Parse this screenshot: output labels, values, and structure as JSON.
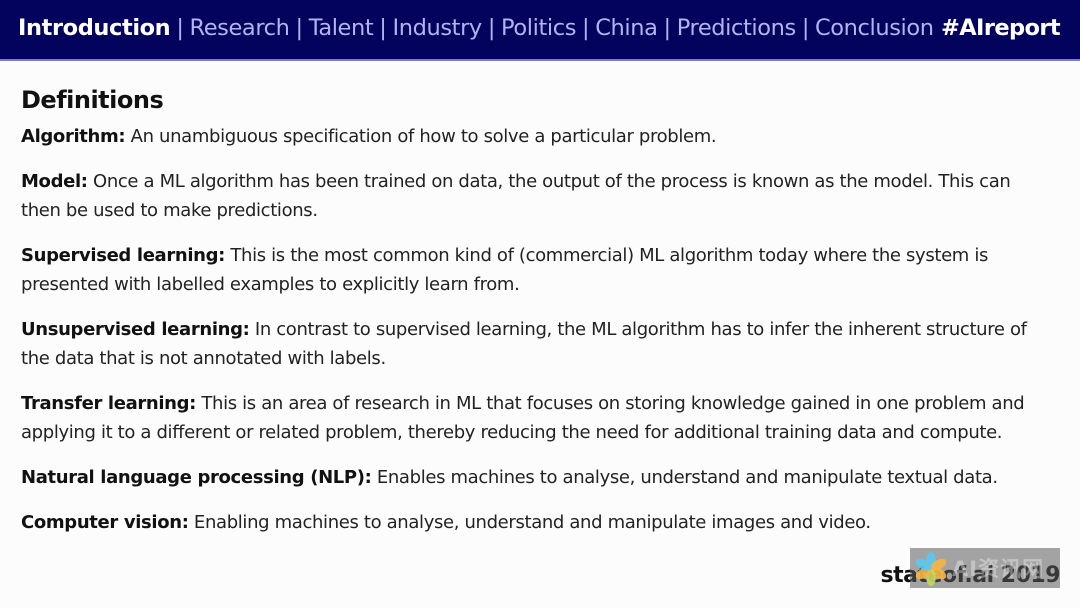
{
  "header": {
    "nav": [
      {
        "label": "Introduction",
        "active": true
      },
      {
        "label": "Research",
        "active": false
      },
      {
        "label": "Talent",
        "active": false
      },
      {
        "label": "Industry",
        "active": false
      },
      {
        "label": "Politics",
        "active": false
      },
      {
        "label": "China",
        "active": false
      },
      {
        "label": "Predictions",
        "active": false
      },
      {
        "label": "Conclusion",
        "active": false
      }
    ],
    "separator": "|",
    "hashtag": "#AIreport",
    "colors": {
      "background": "#03035e",
      "inactive": "#b3b3f0",
      "active": "#ffffff"
    }
  },
  "main": {
    "title": "Definitions",
    "definitions": [
      {
        "term": "Algorithm:",
        "text": " An unambiguous specification of how to solve a particular problem."
      },
      {
        "term": "Model:",
        "text": " Once a ML algorithm has been trained on data, the output of the process is known as the model. This can then be used to make predictions."
      },
      {
        "term": "Supervised learning:",
        "text": " This is the most common kind of (commercial) ML algorithm today where the system is presented with labelled examples to explicitly learn from."
      },
      {
        "term": "Unsupervised learning:",
        "text": " In contrast to supervised learning, the ML algorithm has to infer the inherent structure of the data that is not annotated with labels."
      },
      {
        "term": "Transfer learning:",
        "text": " This is an area of research in ML that focuses on storing knowledge gained in one problem and applying it to a different or related problem, thereby reducing the need for additional training data and compute."
      },
      {
        "term": "Natural language processing (NLP):",
        "text": " Enables machines to analyse, understand and manipulate textual data."
      },
      {
        "term": "Computer vision:",
        "text": " Enabling machines to analyse, understand and manipulate images and video."
      }
    ]
  },
  "footer": {
    "brand": "stateof.ai 2019",
    "watermark_text": "AI资讯网"
  }
}
